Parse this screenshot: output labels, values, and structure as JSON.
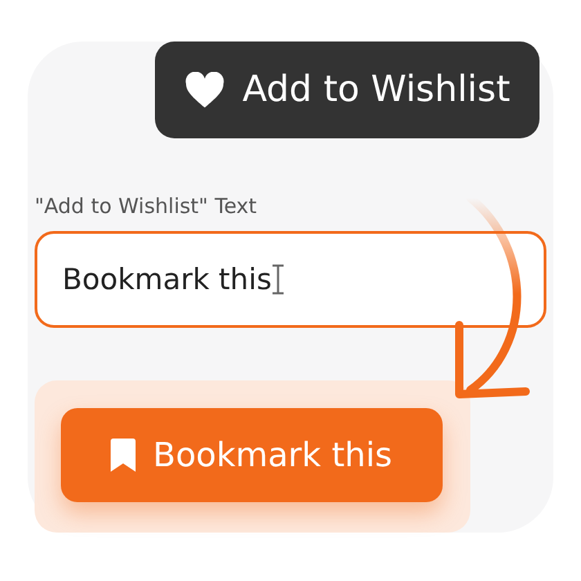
{
  "wishlist_button": {
    "label": "Add to Wishlist"
  },
  "text_field": {
    "label": "\"Add to Wishlist\" Text",
    "value": "Bookmark this"
  },
  "preview_button": {
    "label": "Bookmark this"
  }
}
